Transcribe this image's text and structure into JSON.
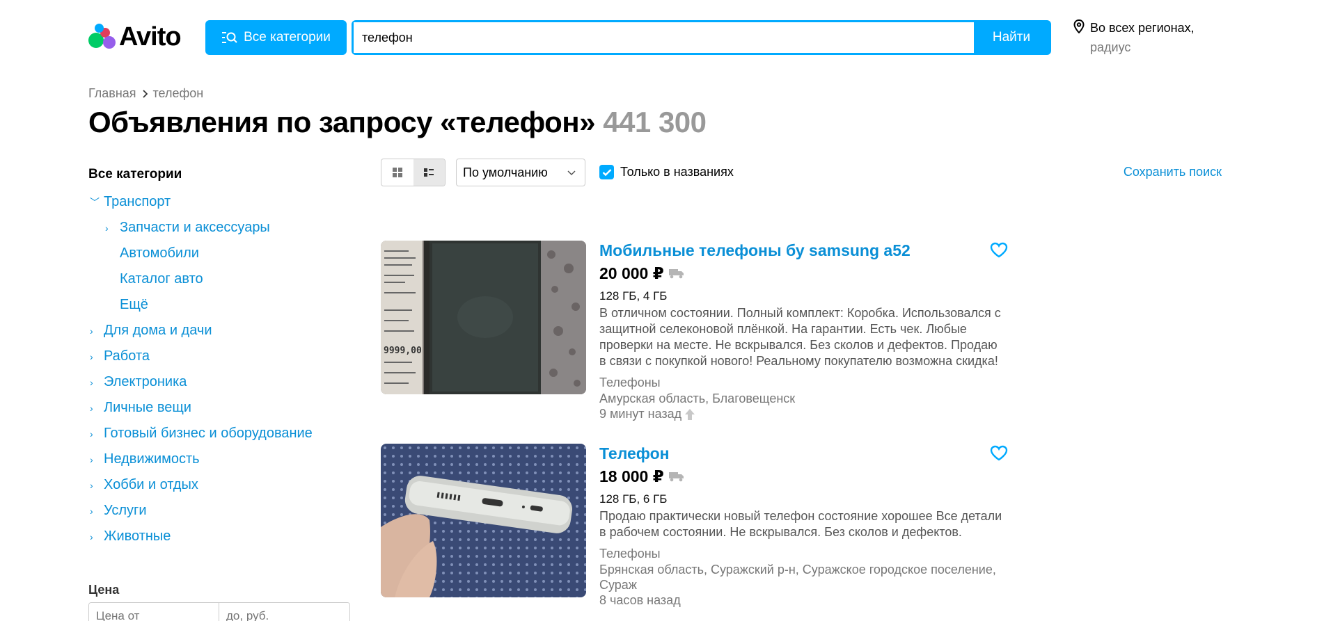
{
  "header": {
    "logo_text": "Avito",
    "all_categories_label": "Все категории",
    "search": {
      "value": "телефон",
      "placeholder": "",
      "button_label": "Найти"
    },
    "region": {
      "line1": "Во всех регионах,",
      "line2": "радиус"
    }
  },
  "breadcrumb": {
    "home": "Главная",
    "current": "телефон"
  },
  "page": {
    "title": "Объявления по запросу «телефон»",
    "count": "441 300"
  },
  "sidebar": {
    "heading": "Все категории",
    "items": [
      {
        "label": "Транспорт",
        "expanded": true
      },
      {
        "label": "Запчасти и аксессуары"
      },
      {
        "label": "Автомобили"
      },
      {
        "label": "Каталог авто"
      },
      {
        "label": "Ещё"
      },
      {
        "label": "Для дома и дачи"
      },
      {
        "label": "Работа"
      },
      {
        "label": "Электроника"
      },
      {
        "label": "Личные вещи"
      },
      {
        "label": "Готовый бизнес и оборудование"
      },
      {
        "label": "Недвижимость"
      },
      {
        "label": "Хобби и отдых"
      },
      {
        "label": "Услуги"
      },
      {
        "label": "Животные"
      }
    ],
    "price": {
      "label": "Цена",
      "from_placeholder": "Цена от",
      "to_placeholder": "до, руб."
    }
  },
  "toolbar": {
    "sort_value": "По умолчанию",
    "title_only_label": "Только в названиях",
    "title_only_checked": true,
    "save_search_label": "Сохранить поиск"
  },
  "listings": [
    {
      "title": "Мобильные телефоны бу samsung a52",
      "price": "20 000 ₽",
      "specs": "128 ГБ, 4 ГБ",
      "description": "В отличном состоянии. Полный комплект: Коробка. Использовался с защитной селеконовой плёнкой. На гарантии. Есть чек. Любые проверки на месте. Не вскрывался. Без сколов и дефектов. Продаю в связи с покупкой нового! Реальному покупателю возможна скидка!",
      "category": "Телефоны",
      "location": "Амурская область, Благовещенск",
      "time": "9 минут назад"
    },
    {
      "title": "Телефон",
      "price": "18 000 ₽",
      "specs": "128 ГБ, 6 ГБ",
      "description": "Продаю практически новый телефон состояние хорошее Все детали в рабочем состоянии. Не вскрывался. Без сколов и дефектов.",
      "category": "Телефоны",
      "location": "Брянская область, Суражский р-н, Суражское городское поселение, Сураж",
      "time": "8 часов назад"
    }
  ],
  "receipt_text": "9999,00",
  "colors": {
    "accent": "#00aaff",
    "link": "#0a8fd6",
    "muted": "#777777"
  }
}
